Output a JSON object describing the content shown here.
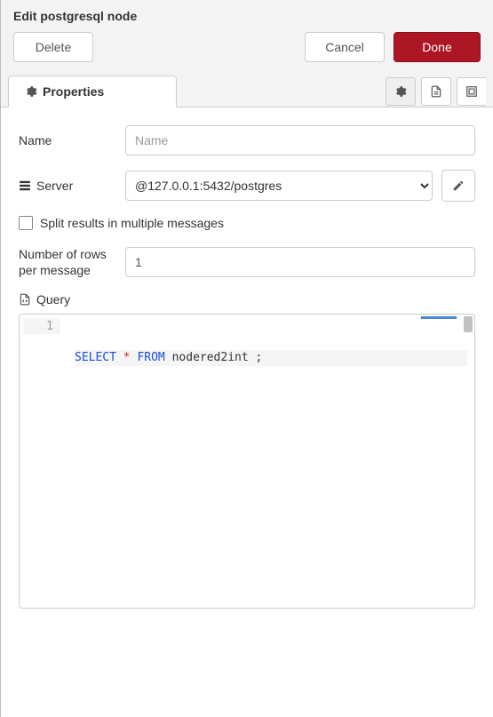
{
  "header": {
    "title": "Edit postgresql node"
  },
  "buttons": {
    "delete": "Delete",
    "cancel": "Cancel",
    "done": "Done"
  },
  "tabs": {
    "properties": "Properties"
  },
  "form": {
    "name": {
      "label": "Name",
      "value": "",
      "placeholder": "Name"
    },
    "server": {
      "label": "Server",
      "selected": "@127.0.0.1:5432/postgres"
    },
    "split": {
      "label": "Split results in multiple messages",
      "checked": false
    },
    "rows": {
      "label": "Number of rows per message",
      "value": "1"
    },
    "query": {
      "label": "Query",
      "line_number": "1",
      "tokens": {
        "select": "SELECT",
        "star": "*",
        "from": "FROM",
        "ident": "nodered2int",
        "semi": ";"
      }
    }
  }
}
